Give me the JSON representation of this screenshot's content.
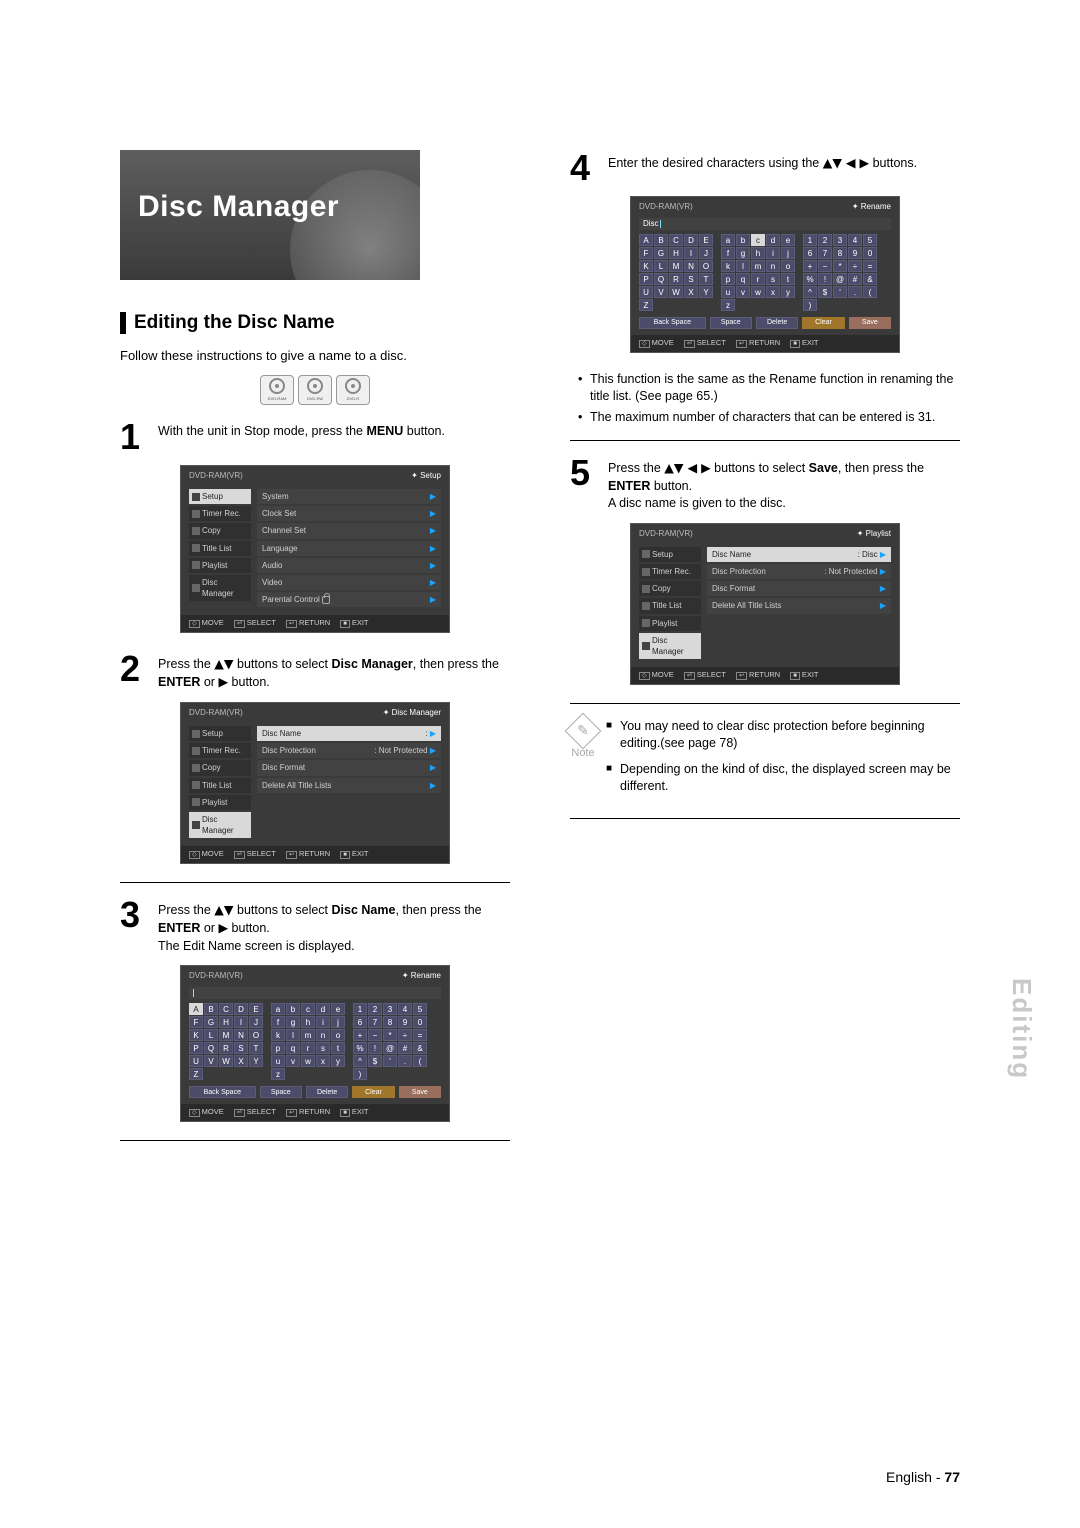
{
  "title": "Disc Manager",
  "section_heading": "Editing the Disc Name",
  "intro": "Follow these instructions to give a name to a disc.",
  "disc_badges": [
    "DVD-RAM",
    "DVD-RW",
    "DVD-R"
  ],
  "steps": {
    "1": {
      "num": "1",
      "text_before": "With the unit in Stop mode, press the ",
      "bold": "MENU",
      "text_after": " button."
    },
    "2": {
      "num": "2",
      "t1": "Press the ",
      "t2": " buttons to select ",
      "b1": "Disc Manager",
      "t3": ", then press the ",
      "b2": "ENTER",
      "t4": " or ",
      "t5": " button."
    },
    "3": {
      "num": "3",
      "t1": "Press the ",
      "t2": " buttons to select ",
      "b1": "Disc Name",
      "t3": ", then press the ",
      "b2": "ENTER",
      "t4": " or ",
      "t5": " button.",
      "extra": "The Edit Name screen is displayed."
    },
    "4": {
      "num": "4",
      "t1": "Enter the desired characters using the ",
      "t2": " buttons."
    },
    "5": {
      "num": "5",
      "t1": "Press the ",
      "t2": " buttons to select ",
      "b1": "Save",
      "t3": ", then press the ",
      "b2": "ENTER",
      "t4": " button.",
      "extra": "A disc name is given to the disc."
    }
  },
  "arrows": {
    "ud": "▲▼",
    "udlr": "▲▼ ◀ ▶",
    "r": "▶"
  },
  "bullets_after4": [
    "This function is the same as the Rename function in renaming the title list. (See page 65.)",
    "The maximum number of characters that can be entered is 31."
  ],
  "note": {
    "label": "Note",
    "items": [
      "You may need to clear disc protection before beginning editing.(see page 78)",
      "Depending on the kind of disc, the displayed screen may be different."
    ]
  },
  "side_label": "Editing",
  "footer": {
    "lang": "English",
    "sep": " - ",
    "page": "77"
  },
  "osd": {
    "dvd": "DVD-RAM(VR)",
    "labels": {
      "setup": "Setup",
      "disc_manager": "Disc Manager",
      "rename": "Rename",
      "playlist": "Playlist"
    },
    "side_items": [
      "Setup",
      "Timer Rec.",
      "Copy",
      "Title List",
      "Playlist",
      "Disc Manager"
    ],
    "setup_menu": [
      "System",
      "Clock Set",
      "Channel Set",
      "Language",
      "Audio",
      "Video",
      "Parental Control"
    ],
    "disc_menu": {
      "name": {
        "l": "Disc Name",
        "v": ":"
      },
      "prot": {
        "l": "Disc Protection",
        "v": ": Not Protected"
      },
      "fmt": "Disc Format",
      "del": "Delete All Title Lists"
    },
    "disc_menu_final_name_value": ": Disc",
    "bottom": {
      "move": "MOVE",
      "select": "SELECT",
      "return": "RETURN",
      "exit": "EXIT"
    },
    "kb": {
      "upper": [
        "A",
        "B",
        "C",
        "D",
        "E",
        "F",
        "G",
        "H",
        "I",
        "J",
        "K",
        "L",
        "M",
        "N",
        "O",
        "P",
        "Q",
        "R",
        "S",
        "T",
        "U",
        "V",
        "W",
        "X",
        "Y",
        "Z"
      ],
      "lower": [
        "a",
        "b",
        "c",
        "d",
        "e",
        "f",
        "g",
        "h",
        "i",
        "j",
        "k",
        "l",
        "m",
        "n",
        "o",
        "p",
        "q",
        "r",
        "s",
        "t",
        "u",
        "v",
        "w",
        "x",
        "y",
        "z"
      ],
      "sym": [
        "1",
        "2",
        "3",
        "4",
        "5",
        "6",
        "7",
        "8",
        "9",
        "0",
        "+",
        "−",
        "*",
        "÷",
        "=",
        "%",
        "!",
        "@",
        "#",
        "&",
        "^",
        "$",
        "'",
        ".",
        "(",
        ")"
      ],
      "btns": {
        "back": "Back Space",
        "space": "Space",
        "delete": "Delete",
        "clear": "Clear",
        "save": "Save"
      },
      "entered": "Disc"
    }
  }
}
